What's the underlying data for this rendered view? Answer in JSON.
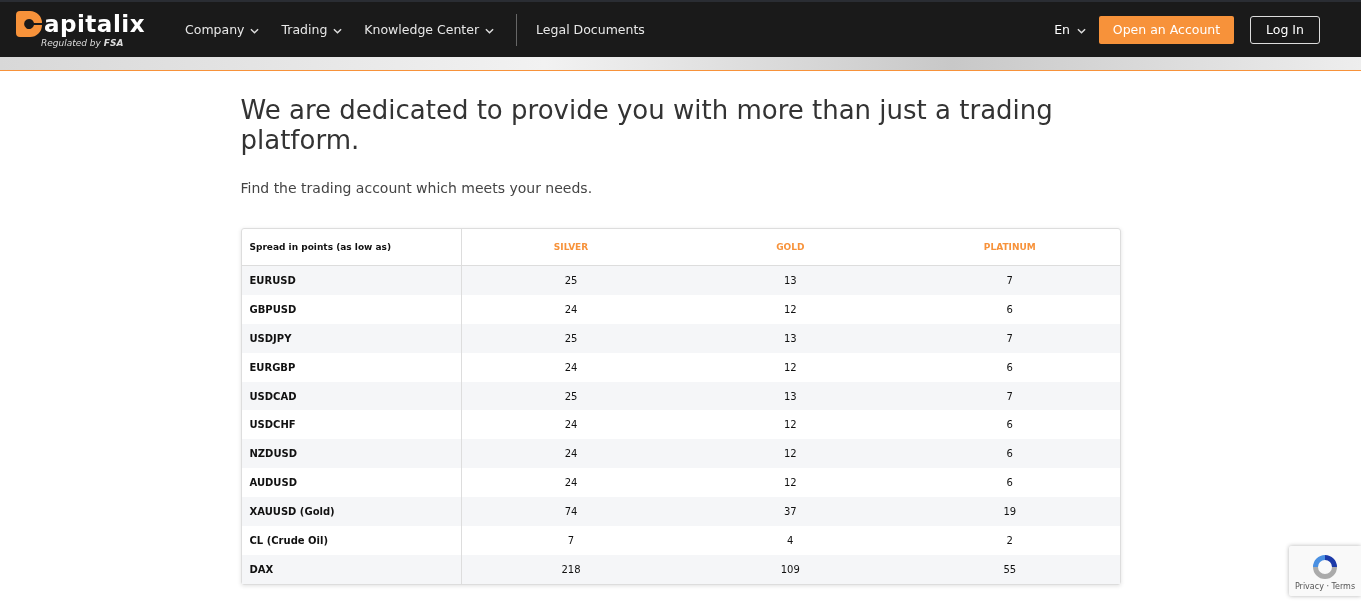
{
  "header": {
    "logo_text": "apitalix",
    "tagline": "Regulated by **FSA**",
    "nav": [
      {
        "label": "Company",
        "dropdown": true
      },
      {
        "label": "Trading",
        "dropdown": true
      },
      {
        "label": "Knowledge Center",
        "dropdown": true
      },
      {
        "label": "Legal Documents",
        "dropdown": false
      }
    ],
    "language": "En",
    "open_account": "Open an Account",
    "login": "Log In"
  },
  "heading": "We are dedicated to provide you with more than just a trading platform.",
  "subheading": "Find the trading account which meets your needs.",
  "table": {
    "columns": [
      "Spread in points (as low as)",
      "SILVER",
      "GOLD",
      "PLATINUM"
    ],
    "rows": [
      [
        "EURUSD",
        "25",
        "13",
        "7"
      ],
      [
        "GBPUSD",
        "24",
        "12",
        "6"
      ],
      [
        "USDJPY",
        "25",
        "13",
        "7"
      ],
      [
        "EURGBP",
        "24",
        "12",
        "6"
      ],
      [
        "USDCAD",
        "25",
        "13",
        "7"
      ],
      [
        "USDCHF",
        "24",
        "12",
        "6"
      ],
      [
        "NZDUSD",
        "24",
        "12",
        "6"
      ],
      [
        "AUDUSD",
        "24",
        "12",
        "6"
      ],
      [
        "XAUUSD (Gold)",
        "74",
        "37",
        "19"
      ],
      [
        "CL (Crude Oil)",
        "7",
        "4",
        "2"
      ],
      [
        "DAX",
        "218",
        "109",
        "55"
      ]
    ]
  },
  "recaptcha": {
    "links": "Privacy · Terms"
  }
}
